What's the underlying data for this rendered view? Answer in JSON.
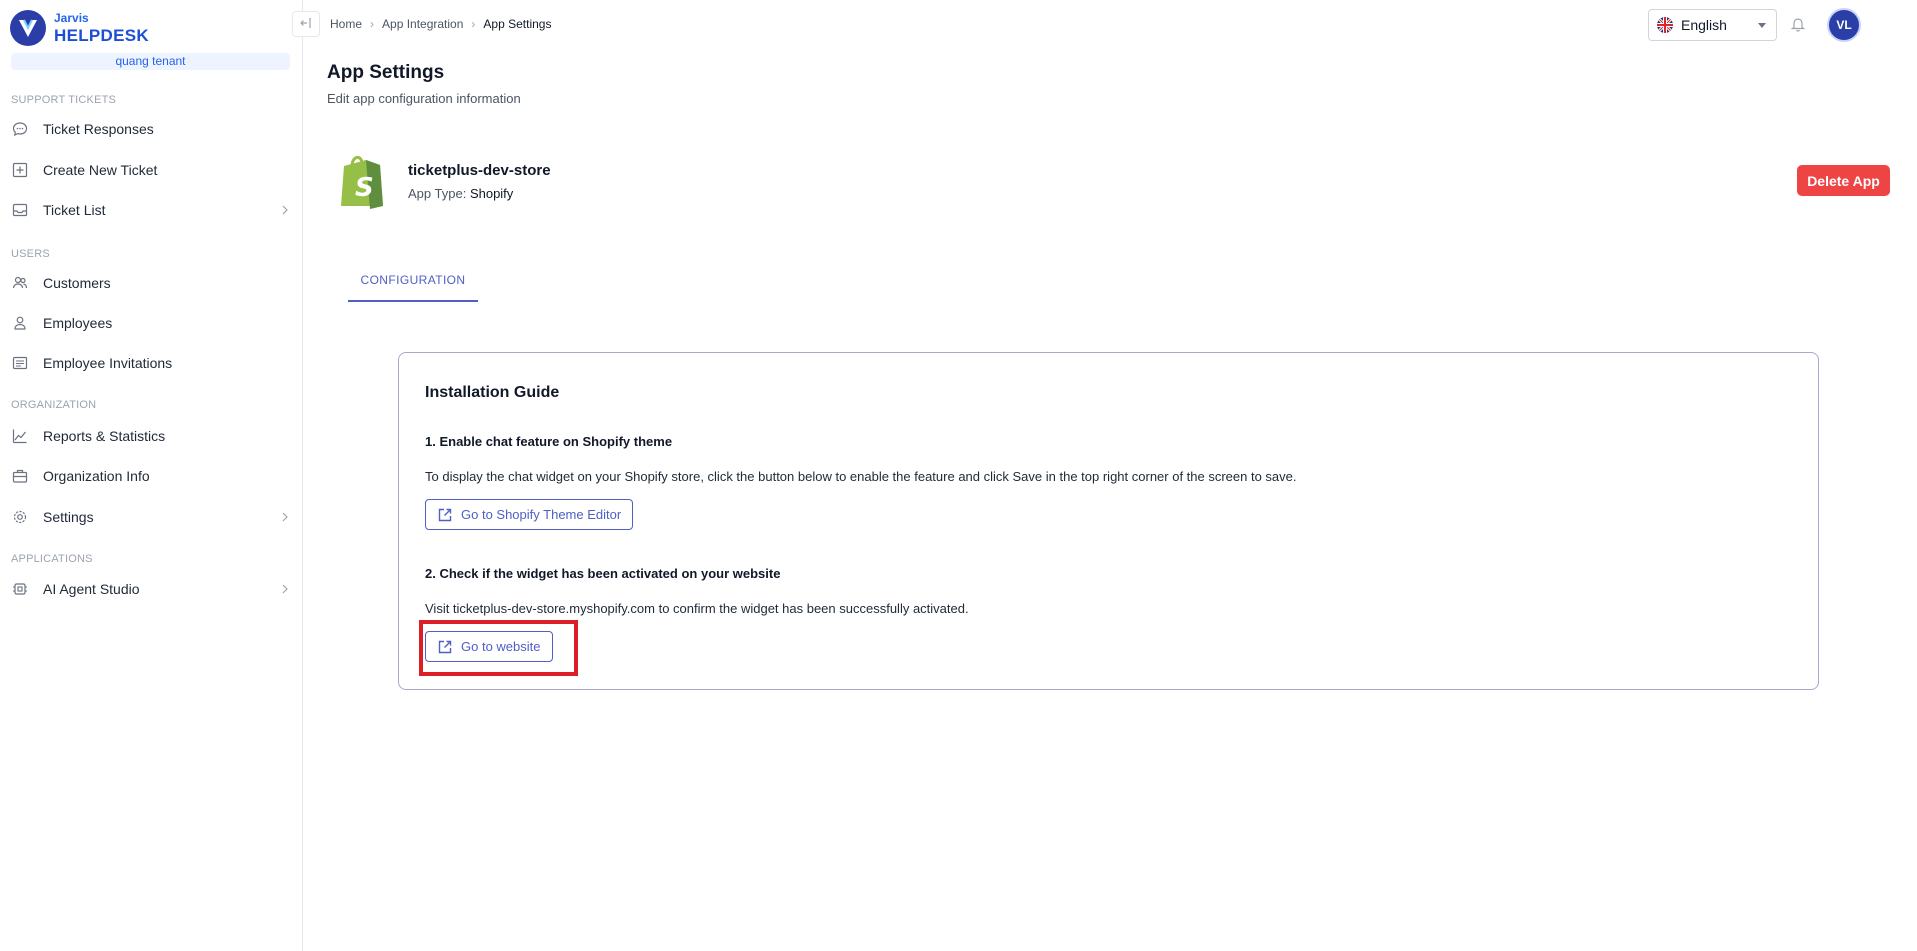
{
  "brand": {
    "small": "Jarvis",
    "big": "HELPDESK",
    "tenant": "quang tenant"
  },
  "sidebar": {
    "sections": [
      {
        "title": "SUPPORT TICKETS",
        "items": [
          {
            "label": "Ticket Responses",
            "icon": "chat-bubble-icon"
          },
          {
            "label": "Create New Ticket",
            "icon": "plus-square-icon"
          },
          {
            "label": "Ticket List",
            "icon": "inbox-icon",
            "has_submenu": true
          }
        ]
      },
      {
        "title": "USERS",
        "items": [
          {
            "label": "Customers",
            "icon": "users-icon"
          },
          {
            "label": "Employees",
            "icon": "user-icon"
          },
          {
            "label": "Employee Invitations",
            "icon": "list-icon"
          }
        ]
      },
      {
        "title": "ORGANIZATION",
        "items": [
          {
            "label": "Reports & Statistics",
            "icon": "chart-line-icon"
          },
          {
            "label": "Organization Info",
            "icon": "briefcase-icon"
          },
          {
            "label": "Settings",
            "icon": "gear-icon",
            "has_submenu": true
          }
        ]
      },
      {
        "title": "APPLICATIONS",
        "items": [
          {
            "label": "AI Agent Studio",
            "icon": "chip-icon",
            "has_submenu": true
          }
        ]
      }
    ]
  },
  "breadcrumb": {
    "items": [
      "Home",
      "App Integration",
      "App Settings"
    ],
    "separator": "›"
  },
  "header": {
    "language": "English",
    "avatar_initials": "VL"
  },
  "page": {
    "title": "App Settings",
    "subtitle": "Edit app configuration information"
  },
  "app": {
    "name": "ticketplus-dev-store",
    "type_label": "App Type:",
    "type_value": "Shopify",
    "delete_label": "Delete App"
  },
  "tabs": [
    {
      "label": "CONFIGURATION",
      "active": true
    }
  ],
  "guide": {
    "title": "Installation Guide",
    "step1": {
      "title": "1. Enable chat feature on Shopify theme",
      "text": "To display the chat widget on your Shopify store, click the button below to enable the feature and click Save in the top right corner of the screen to save.",
      "button": "Go to Shopify Theme Editor"
    },
    "step2": {
      "title": "2. Check if the widget has been activated on your website",
      "text": "Visit ticketplus-dev-store.myshopify.com to confirm the widget has been successfully activated.",
      "button": "Go to website"
    }
  },
  "colors": {
    "accent": "#4f5fc4",
    "danger": "#ef4444",
    "brand": "#2b3ea8",
    "highlight": "#dc1f26",
    "shopify": "#95bf47"
  }
}
